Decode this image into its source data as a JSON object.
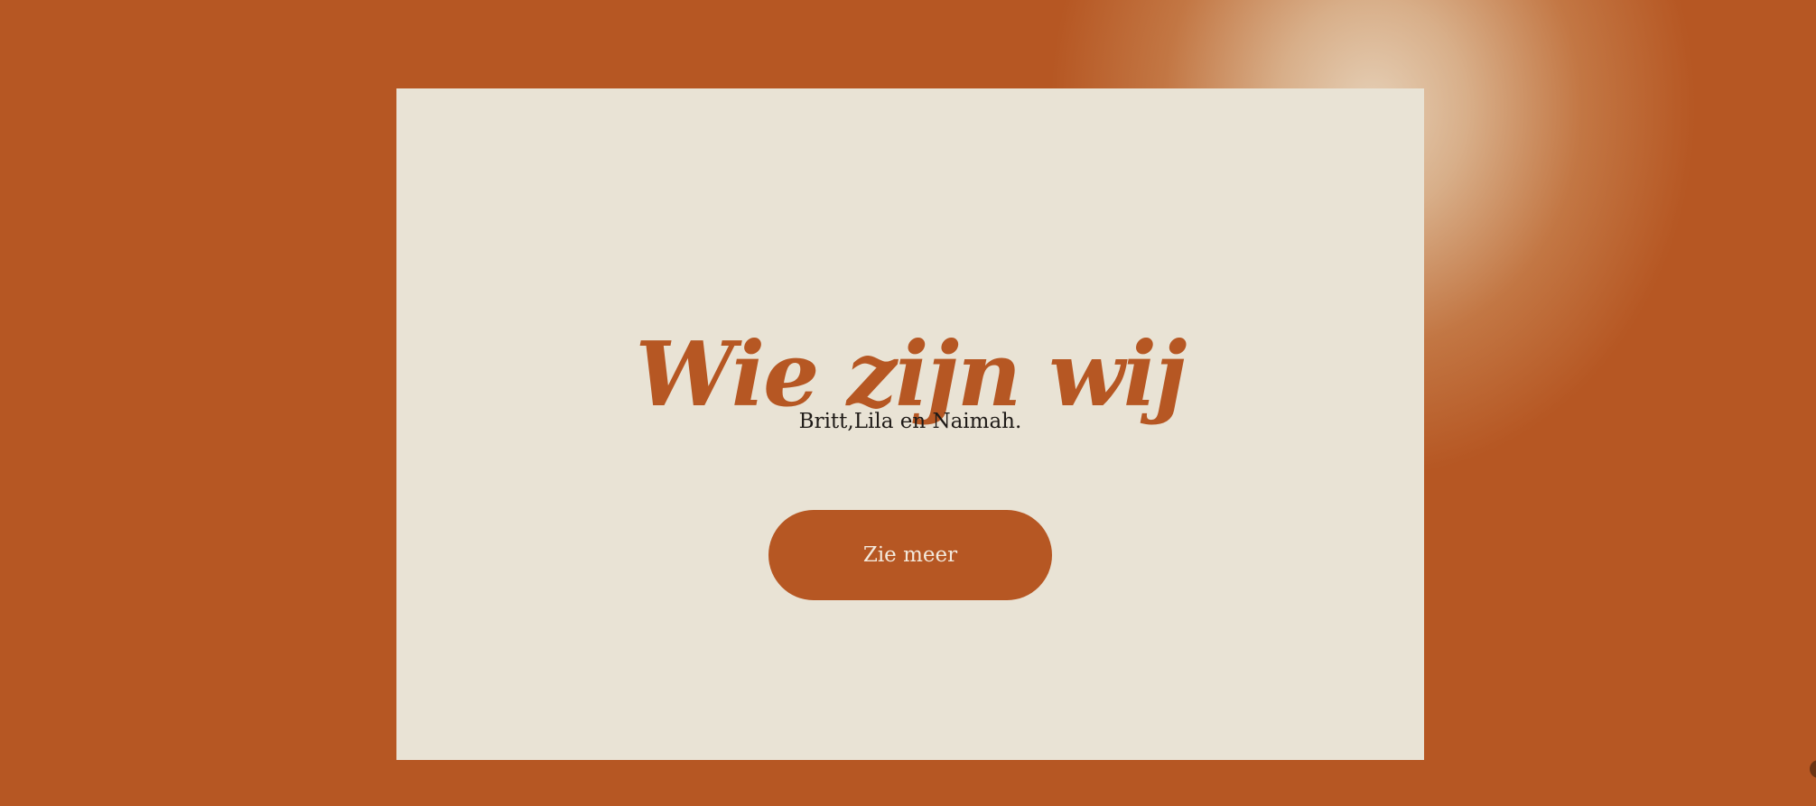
{
  "hero": {
    "title": "Wie zijn wij",
    "subtitle": "Britt,Lila en Naimah.",
    "cta_label": "Zie meer"
  },
  "colors": {
    "background": "#B65723",
    "card": "#E9E3D5",
    "accent": "#B65723",
    "text": "#1E1A17",
    "button_text": "#F3E9DC"
  }
}
